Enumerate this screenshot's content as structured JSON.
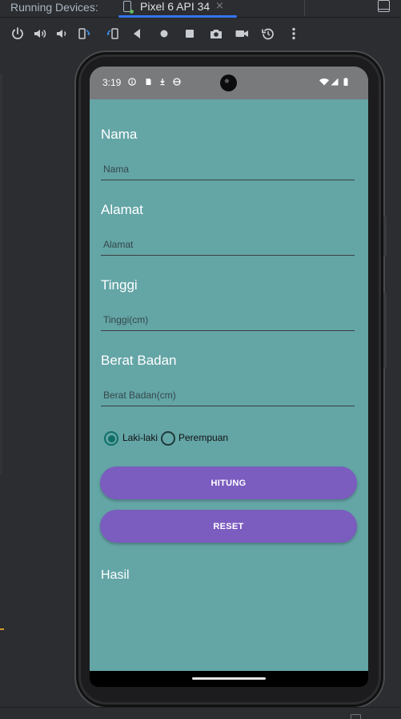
{
  "ide": {
    "running_devices_label": "Running Devices:",
    "device_tab_label": "Pixel 6 API 34",
    "tab_close": "×",
    "accent": "#3574f0",
    "toolbar_icons": [
      "power-icon",
      "volume-up-icon",
      "volume-down-icon",
      "rotate-left-icon",
      "rotate-right-icon",
      "back-icon",
      "home-icon",
      "overview-icon",
      "screenshot-icon",
      "screen-record-icon",
      "reset-icon",
      "more-icon"
    ]
  },
  "status_bar": {
    "time": "3:19",
    "left_icons": [
      "info-icon",
      "sd-card-icon",
      "download-icon",
      "data-saver-icon"
    ],
    "right_icons": [
      "wifi-icon",
      "signal-icon",
      "battery-icon"
    ],
    "background": "#787a7c"
  },
  "form": {
    "background": "#64a5a6",
    "fields": [
      {
        "label": "Nama",
        "placeholder": "Nama"
      },
      {
        "label": "Alamat",
        "placeholder": "Alamat"
      },
      {
        "label": "Tinggi",
        "placeholder": "Tinggi(cm)"
      },
      {
        "label": "Berat Badan",
        "placeholder": "Berat Badan(cm)"
      }
    ],
    "gender": {
      "options": [
        "Laki-laki",
        "Perempuan"
      ],
      "selected": "Laki-laki"
    },
    "buttons": {
      "hitung": "HITUNG",
      "reset": "RESET",
      "color": "#7b5cbf"
    },
    "result_label": "Hasil"
  }
}
